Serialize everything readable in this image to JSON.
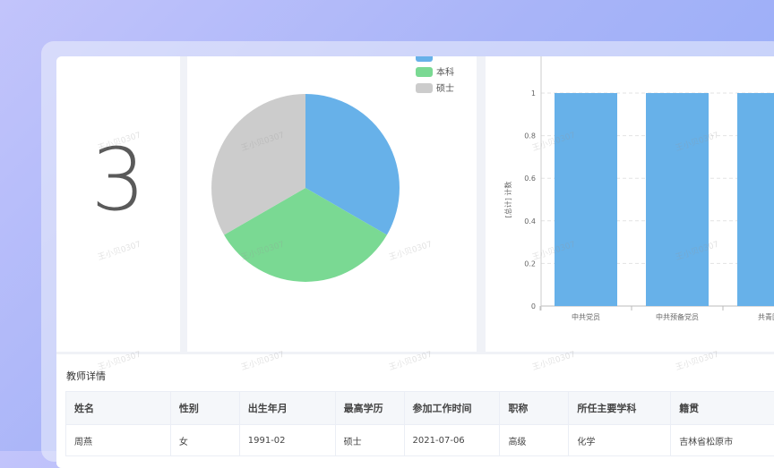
{
  "stat_card": {
    "value": "3"
  },
  "pie": {
    "legend": [
      {
        "label": "",
        "color": "#67b1e9"
      },
      {
        "label": "本科",
        "color": "#7ad993"
      },
      {
        "label": "硕士",
        "color": "#cccccc"
      }
    ]
  },
  "chart_data": {
    "type": "bar",
    "categories": [
      "中共党员",
      "中共预备党员",
      "共青团"
    ],
    "values": [
      1,
      1,
      1
    ],
    "ylabel": "[总计] 计数",
    "ylim": [
      0,
      1
    ],
    "yticks": [
      "0",
      "0.2",
      "0.4",
      "0.6",
      "0.8",
      "1"
    ],
    "grid": true,
    "color": "#67b1e9"
  },
  "teacher_details": {
    "title": "教师详情",
    "columns": [
      "姓名",
      "性别",
      "出生年月",
      "最高学历",
      "参加工作时间",
      "职称",
      "所任主要学科",
      "籍贯"
    ],
    "rows": [
      [
        "周燕",
        "女",
        "1991-02",
        "硕士",
        "2021-07-06",
        "高级",
        "化学",
        "吉林省松原市"
      ]
    ]
  },
  "watermark": "王小贝0307"
}
